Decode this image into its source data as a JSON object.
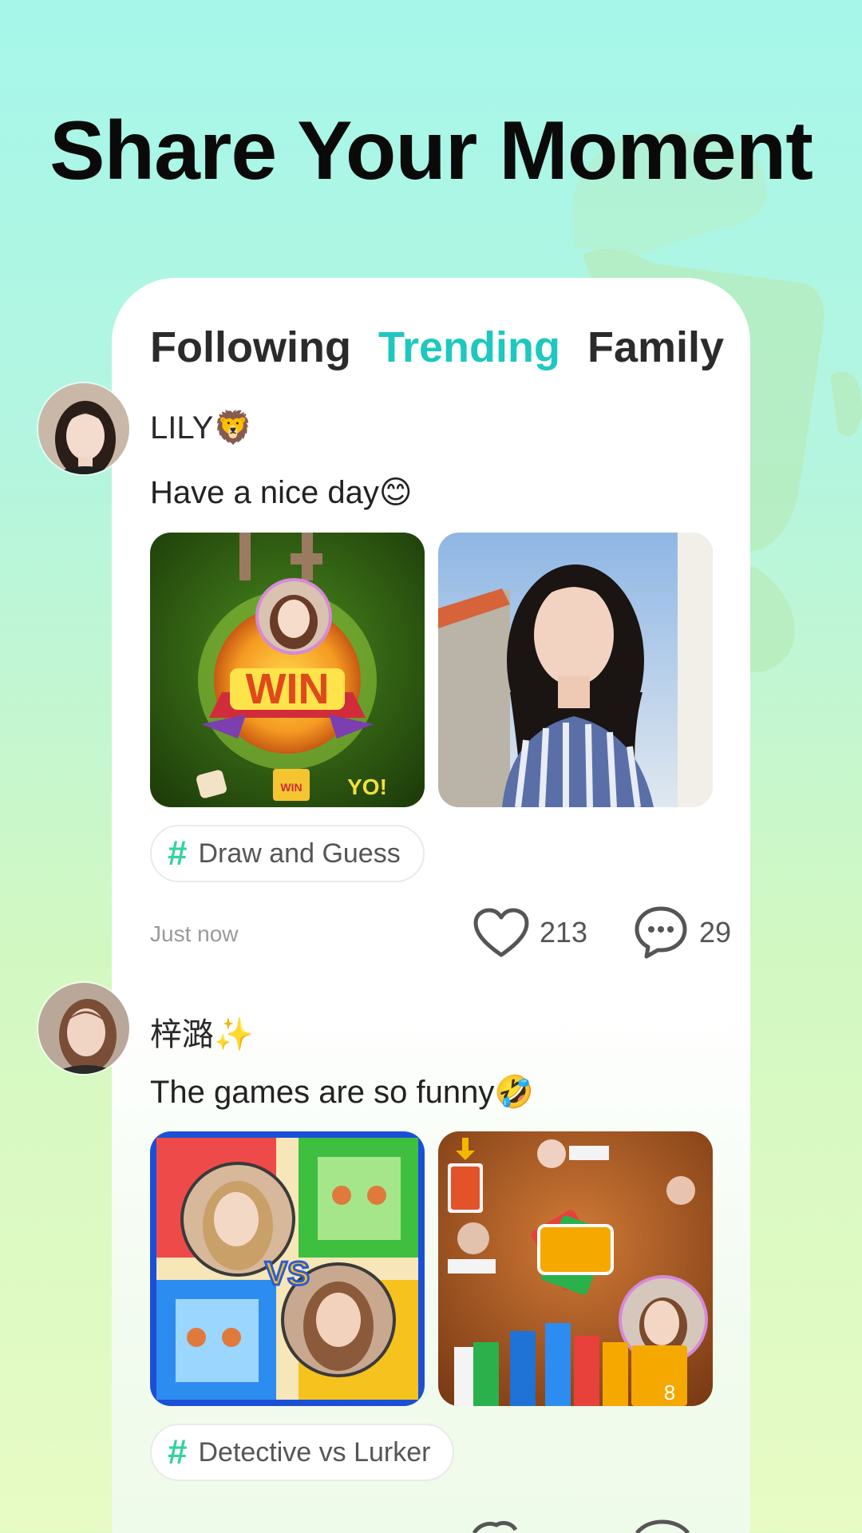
{
  "headline": "Share Your Moment",
  "tabs": [
    {
      "label": "Following",
      "active": false
    },
    {
      "label": "Trending",
      "active": true
    },
    {
      "label": "Family",
      "active": false
    }
  ],
  "colors": {
    "accent": "#1ec8bf",
    "hashtag": "#33d39a",
    "background_top": "#a6f7ea",
    "background_bottom": "#e8fbc4"
  },
  "posts": [
    {
      "username": "LILY🦁",
      "text": "Have a nice day😊",
      "images": [
        "win-game-screen-photo",
        "girl-selfie-photo"
      ],
      "tag": "Draw and Guess",
      "time": "Just now",
      "likes": "213",
      "comments": "29"
    },
    {
      "username": "梓潞✨",
      "text": "The games are so funny🤣",
      "images": [
        "ludo-game-board-photo",
        "uno-card-game-photo"
      ],
      "tag": "Detective vs Lurker"
    }
  ],
  "icons": {
    "like": "heart-icon",
    "comment": "comment-bubble-icon",
    "tag": "hashtag-icon"
  }
}
